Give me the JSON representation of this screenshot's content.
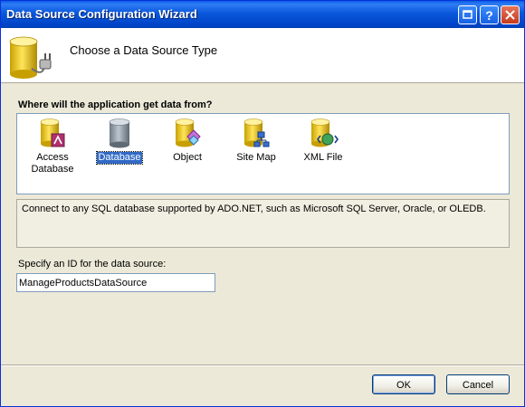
{
  "window": {
    "title": "Data Source Configuration Wizard"
  },
  "header": {
    "title": "Choose a Data Source Type",
    "icon": "database-plug-icon"
  },
  "prompt": "Where will the application get data from?",
  "types": [
    {
      "label": "Access Database",
      "icon": "access-database-icon",
      "selected": false
    },
    {
      "label": "Database",
      "icon": "database-icon",
      "selected": true
    },
    {
      "label": "Object",
      "icon": "object-icon",
      "selected": false
    },
    {
      "label": "Site Map",
      "icon": "site-map-icon",
      "selected": false
    },
    {
      "label": "XML File",
      "icon": "xml-file-icon",
      "selected": false
    }
  ],
  "description": "Connect to any SQL database supported by ADO.NET, such as Microsoft SQL Server, Oracle, or OLEDB.",
  "id_field": {
    "label": "Specify an ID for the data source:",
    "value": "ManageProductsDataSource"
  },
  "buttons": {
    "ok": "OK",
    "cancel": "Cancel"
  },
  "colors": {
    "titlebar": "#0054e3",
    "selection": "#316ac5",
    "dialog": "#ece9d8"
  }
}
